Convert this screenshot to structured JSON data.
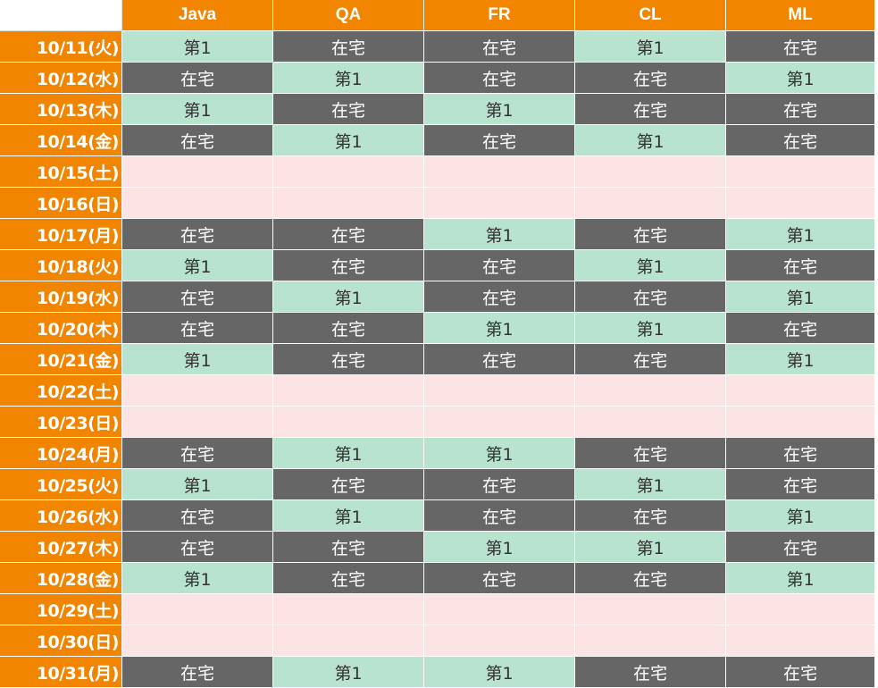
{
  "header": {
    "columns": [
      "Java",
      "QA",
      "FR",
      "CL",
      "ML"
    ]
  },
  "colors": {
    "header": "#f28500",
    "home": "#666666",
    "office": "#b8e3cf",
    "weekend": "#fce4e4"
  },
  "rows": [
    {
      "date": "10/11(火)",
      "cells": [
        "第1",
        "在宅",
        "在宅",
        "第1",
        "在宅"
      ]
    },
    {
      "date": "10/12(水)",
      "cells": [
        "在宅",
        "第1",
        "在宅",
        "在宅",
        "第1"
      ]
    },
    {
      "date": "10/13(木)",
      "cells": [
        "第1",
        "在宅",
        "第1",
        "在宅",
        "在宅"
      ]
    },
    {
      "date": "10/14(金)",
      "cells": [
        "在宅",
        "第1",
        "在宅",
        "第1",
        "在宅"
      ]
    },
    {
      "date": "10/15(土)",
      "cells": [
        "",
        "",
        "",
        "",
        ""
      ]
    },
    {
      "date": "10/16(日)",
      "cells": [
        "",
        "",
        "",
        "",
        ""
      ]
    },
    {
      "date": "10/17(月)",
      "cells": [
        "在宅",
        "在宅",
        "第1",
        "在宅",
        "第1"
      ]
    },
    {
      "date": "10/18(火)",
      "cells": [
        "第1",
        "在宅",
        "在宅",
        "第1",
        "在宅"
      ]
    },
    {
      "date": "10/19(水)",
      "cells": [
        "在宅",
        "第1",
        "在宅",
        "在宅",
        "第1"
      ]
    },
    {
      "date": "10/20(木)",
      "cells": [
        "在宅",
        "在宅",
        "第1",
        "第1",
        "在宅"
      ]
    },
    {
      "date": "10/21(金)",
      "cells": [
        "第1",
        "在宅",
        "在宅",
        "在宅",
        "第1"
      ]
    },
    {
      "date": "10/22(土)",
      "cells": [
        "",
        "",
        "",
        "",
        ""
      ]
    },
    {
      "date": "10/23(日)",
      "cells": [
        "",
        "",
        "",
        "",
        ""
      ]
    },
    {
      "date": "10/24(月)",
      "cells": [
        "在宅",
        "第1",
        "第1",
        "在宅",
        "在宅"
      ]
    },
    {
      "date": "10/25(火)",
      "cells": [
        "第1",
        "在宅",
        "在宅",
        "第1",
        "在宅"
      ]
    },
    {
      "date": "10/26(水)",
      "cells": [
        "在宅",
        "第1",
        "在宅",
        "在宅",
        "第1"
      ]
    },
    {
      "date": "10/27(木)",
      "cells": [
        "在宅",
        "在宅",
        "第1",
        "第1",
        "在宅"
      ]
    },
    {
      "date": "10/28(金)",
      "cells": [
        "第1",
        "在宅",
        "在宅",
        "在宅",
        "第1"
      ]
    },
    {
      "date": "10/29(土)",
      "cells": [
        "",
        "",
        "",
        "",
        ""
      ]
    },
    {
      "date": "10/30(日)",
      "cells": [
        "",
        "",
        "",
        "",
        ""
      ]
    },
    {
      "date": "10/31(月)",
      "cells": [
        "在宅",
        "第1",
        "第1",
        "在宅",
        "在宅"
      ]
    }
  ]
}
